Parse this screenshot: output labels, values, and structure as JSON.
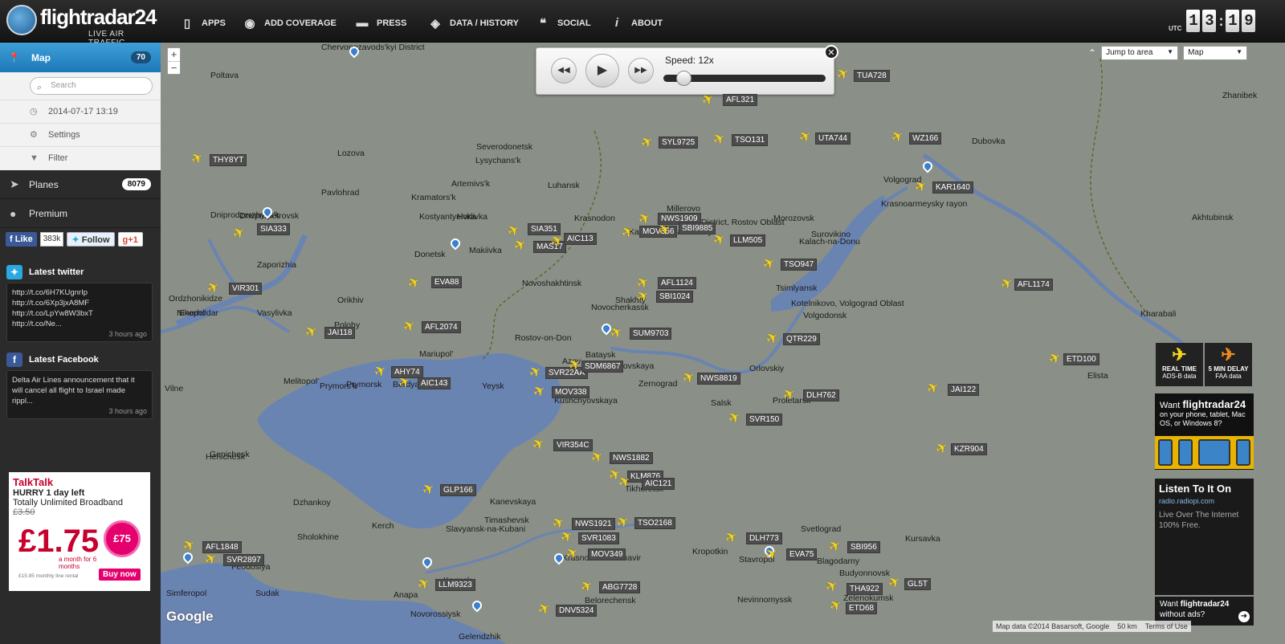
{
  "header": {
    "logo_text": "flightradar24",
    "logo_sub": "LIVE AIR TRAFFIC",
    "nav": [
      {
        "label": "APPS",
        "icon": "phone-icon"
      },
      {
        "label": "ADD COVERAGE",
        "icon": "eye-icon"
      },
      {
        "label": "PRESS",
        "icon": "speech-bubble-icon"
      },
      {
        "label": "DATA / HISTORY",
        "icon": "box-icon"
      },
      {
        "label": "SOCIAL",
        "icon": "quote-icon"
      },
      {
        "label": "ABOUT",
        "icon": "info-icon"
      }
    ],
    "clock": {
      "label": "UTC",
      "hour": "13",
      "minute": "19"
    }
  },
  "sidebar": {
    "map_label": "Map",
    "map_count": "70",
    "search_placeholder": "Search",
    "datetime": "2014-07-17 13:19",
    "settings": "Settings",
    "filter": "Filter",
    "planes_label": "Planes",
    "planes_count": "8079",
    "premium": "Premium",
    "social": {
      "like": "Like",
      "like_count": "383k",
      "follow": "Follow",
      "gplus": "+1"
    },
    "twitter": {
      "title": "Latest twitter",
      "lines": [
        "http://t.co/6H7KUgnrIp",
        "http://t.co/6Xp3jxA8MF",
        "http://t.co/LpYw8W3bxT",
        "http://t.co/Ne..."
      ],
      "ago": "3 hours ago"
    },
    "facebook": {
      "title": "Latest Facebook",
      "text": "Delta Air Lines announcement that it will cancel all flight to Israel made rippl...",
      "ago": "3 hours ago"
    },
    "ad": {
      "brand": "TalkTalk",
      "line1": "HURRY 1 day left",
      "line2": "Totally Unlimited Broadband",
      "old_price": "£3.50",
      "price": "£1.75",
      "month": "a month for 6 months",
      "voucher": "£75",
      "fine": "£15.95 monthly line rental",
      "buy": "Buy now"
    }
  },
  "player": {
    "speed_label": "Speed: 12x",
    "speed": 12
  },
  "controls": {
    "jump": "Jump to area",
    "maptype": "Map"
  },
  "legend": {
    "realtime": "REAL TIME",
    "realtime_sub": "ADS-B data",
    "delay": "5 MIN DELAY",
    "delay_sub": "FAA data"
  },
  "ads_right": {
    "promo_pre": "Want",
    "promo_brand": "flightradar24",
    "promo_text": "on your phone, tablet, Mac OS, or Windows 8?",
    "radio_title": "Listen To It On",
    "radio_url": "radio.radiopi.com",
    "radio_desc": "Live Over The Internet 100% Free.",
    "noads": "without ads?"
  },
  "map": {
    "attribution": "Map data ©2014 Basarsoft, Google",
    "scale": "50 km",
    "terms": "Terms of Use",
    "google": "Google",
    "cities": [
      "Chervonozavods'kyi District",
      "Poltava",
      "Lozova",
      "Severodonetsk",
      "Lysychans'k",
      "Artemivs'k",
      "Luhansk",
      "Kramators'k",
      "Kostyantynivka",
      "Horlivka",
      "Dniprodzerzhyns'k",
      "Pavlohrad",
      "Dnepropetrovsk",
      "Zaporizhia",
      "Donetsk",
      "Makiivka",
      "Novoshakhtinsk",
      "Krasnodon",
      "Millerovo",
      "Millerovsky District, Rostov Oblast",
      "Kamensk-Shakhtinsky",
      "Morozovsk",
      "Surovikino",
      "Kalach-na-Donu",
      "Volgograd",
      "Krasnoarmeysky rayon",
      "Dubovka",
      "Zhanibek",
      "Akhtubinsk",
      "Tsimlyansk",
      "Volgodonsk",
      "Kotelnikovo, Volgograd Oblast",
      "Shakhty",
      "Novocherkassk",
      "Rostov-on-Don",
      "Mariupol'",
      "Berdyans'k",
      "Melitopol'",
      "Vasylivka",
      "Nikopol'",
      "Enerhodar",
      "Orikhiv",
      "Polohy",
      "Prymors'k",
      "Bataysk",
      "Azov",
      "Yeysk",
      "Kirovskaya",
      "Zernograd",
      "Kushchyovskaya",
      "Salsk",
      "Proletarsk",
      "Orlovskiy",
      "Elista",
      "Kharabali",
      "Genichesk",
      "Kanevskaya",
      "Timashevsk",
      "Dzhankoy",
      "Kerch",
      "Feodosiya",
      "Simferopol",
      "Sudak",
      "Sholokhine",
      "Slavyansk-na-Kubani",
      "Krasnodar",
      "Krymsk",
      "Anapa",
      "Novorossiysk",
      "Gelendzhik",
      "Belorechensk",
      "Armavir",
      "Kropotkin",
      "Stavropol",
      "Nevinnomyssk",
      "Svetlograd",
      "Blagodarny",
      "Budyonnovsk",
      "Zelenokumsk",
      "Ordzhonikidze",
      "Tikhoretsk",
      "Kursavka",
      "Vilne",
      "Henichesk",
      "Prymorsk"
    ],
    "flights": [
      "THY8YT",
      "SIA333",
      "VIR301",
      "EVA88",
      "JAI118",
      "AFL2074",
      "AHY74",
      "AIC143",
      "SIA351",
      "MAS17",
      "AIC113",
      "NWS1909",
      "MOV356",
      "SBI9885",
      "LLM505",
      "AFL1124",
      "SBI1024",
      "SUM9703",
      "SVR22AA",
      "SDM6867",
      "MOV338",
      "NWS8819",
      "TSO947",
      "QTR229",
      "DLH762",
      "SVR150",
      "VIR354C",
      "NWS1882",
      "KLM876",
      "AIC121",
      "GLP166",
      "NWS1921",
      "TSO2168",
      "SVR1083",
      "MOV349",
      "DLH773",
      "EVA75",
      "SBI956",
      "AFL1848",
      "SVR2897",
      "LLM9323",
      "ABG7728",
      "DNV5324",
      "THA922",
      "GL5T",
      "ETD68",
      "AFL321",
      "SYL9725",
      "TSO131",
      "UTA744",
      "WZ166",
      "KAR1640",
      "TUA728",
      "AFL1174",
      "ETD100",
      "JAI122",
      "KZR904"
    ]
  }
}
